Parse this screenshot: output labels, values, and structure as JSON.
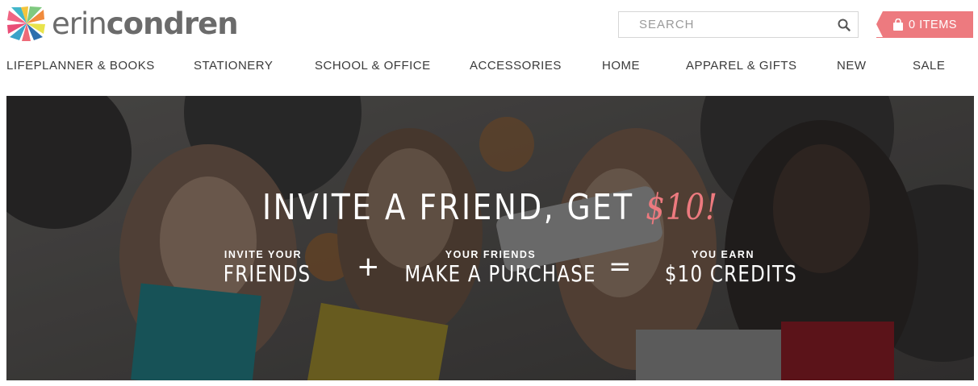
{
  "brand": {
    "name_light": "erin",
    "name_bold": "condren"
  },
  "search": {
    "placeholder": "SEARCH",
    "icon": "search-icon"
  },
  "cart": {
    "label": "0 ITEMS",
    "icon": "shopping-bag-icon"
  },
  "nav": [
    "LIFEPLANNER & BOOKS",
    "STATIONERY",
    "SCHOOL & OFFICE",
    "ACCESSORIES",
    "HOME",
    "APPAREL & GIFTS",
    "NEW",
    "SALE"
  ],
  "hero": {
    "title_prefix": "INVITE A FRIEND, GET ",
    "title_amount": "$10!",
    "steps": [
      {
        "small": "INVITE YOUR",
        "big": "FRIENDS"
      },
      {
        "small": "YOUR FRIENDS",
        "big": "MAKE A PURCHASE"
      },
      {
        "small": "YOU EARN",
        "big": "$10 CREDITS"
      }
    ],
    "op_plus": "+",
    "op_equals": "="
  },
  "colors": {
    "accent": "#ed7a7f",
    "text": "#3a3a3a",
    "logo_gray": "#6b6b6b"
  }
}
